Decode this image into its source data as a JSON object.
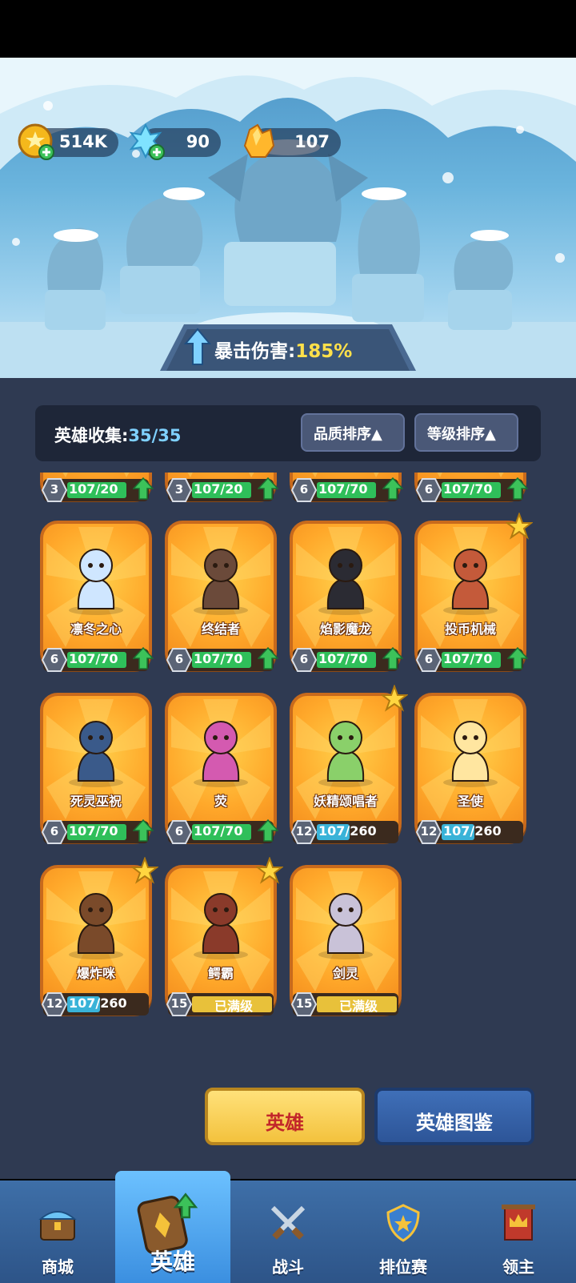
{
  "resources": {
    "coins": "514K",
    "crystals": "90",
    "gems": "107"
  },
  "banner": {
    "label": "暴击伤害:",
    "value": "185%"
  },
  "collection": {
    "label": "英雄收集:",
    "count": "35/35",
    "sort_quality": "品质排序▲",
    "sort_level": "等级排序▲"
  },
  "partial_row": [
    {
      "level": "3",
      "progress": "107/20",
      "fill": 1.0,
      "upgradable": true
    },
    {
      "level": "3",
      "progress": "107/20",
      "fill": 1.0,
      "upgradable": true
    },
    {
      "level": "6",
      "progress": "107/70",
      "fill": 1.0,
      "upgradable": true
    },
    {
      "level": "6",
      "progress": "107/70",
      "fill": 1.0,
      "upgradable": true
    }
  ],
  "heroes": [
    {
      "name": "凛冬之心",
      "level": "6",
      "progress": "107/70",
      "fill": 1.0,
      "upgradable": true,
      "star": false
    },
    {
      "name": "终结者",
      "level": "6",
      "progress": "107/70",
      "fill": 1.0,
      "upgradable": true,
      "star": false
    },
    {
      "name": "焰影魔龙",
      "level": "6",
      "progress": "107/70",
      "fill": 1.0,
      "upgradable": true,
      "star": false
    },
    {
      "name": "投币机械",
      "level": "6",
      "progress": "107/70",
      "fill": 1.0,
      "upgradable": true,
      "star": true
    },
    {
      "name": "死灵巫祝",
      "level": "6",
      "progress": "107/70",
      "fill": 1.0,
      "upgradable": true,
      "star": false
    },
    {
      "name": "荧",
      "level": "6",
      "progress": "107/70",
      "fill": 1.0,
      "upgradable": true,
      "star": false
    },
    {
      "name": "妖精颂唱者",
      "level": "12",
      "progress": "107/260",
      "fill": 0.41,
      "upgradable": false,
      "star": true
    },
    {
      "name": "圣使",
      "level": "12",
      "progress": "107/260",
      "fill": 0.41,
      "upgradable": false,
      "star": false
    },
    {
      "name": "爆炸咪",
      "level": "12",
      "progress": "107/260",
      "fill": 0.41,
      "upgradable": false,
      "star": true
    },
    {
      "name": "鳄霸",
      "level": "15",
      "progress": "已满级",
      "fill": 1.0,
      "upgradable": false,
      "star": true,
      "maxed": true
    },
    {
      "name": "剑灵",
      "level": "15",
      "progress": "已满级",
      "fill": 1.0,
      "upgradable": false,
      "star": false,
      "maxed": true
    }
  ],
  "buttons": {
    "heroes": "英雄",
    "codex": "英雄图鉴"
  },
  "nav": [
    {
      "label": "商城",
      "icon": "shop-chest-icon"
    },
    {
      "label": "英雄",
      "icon": "hero-card-icon"
    },
    {
      "label": "战斗",
      "icon": "crossed-swords-icon"
    },
    {
      "label": "排位赛",
      "icon": "rank-shield-icon"
    },
    {
      "label": "领主",
      "icon": "crown-banner-icon"
    }
  ],
  "colors": {
    "panel": "#2f3a52",
    "card_orange": "#ffa82a",
    "progress_green": "#2fbf5a",
    "accent_yellow": "#ffe04a",
    "nav_blue": "#3e6fa8"
  }
}
